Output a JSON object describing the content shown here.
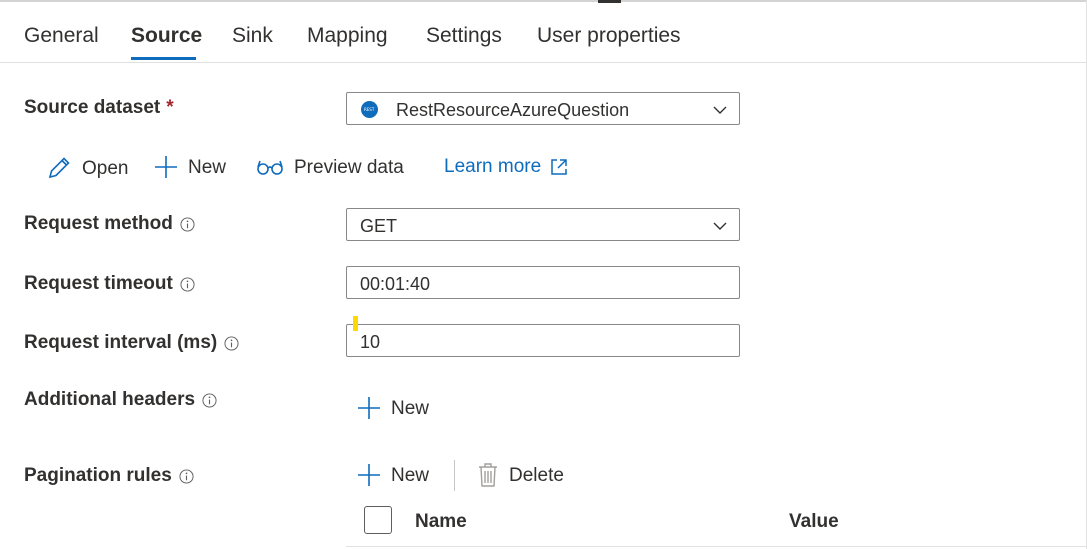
{
  "tabs": [
    {
      "label": "General"
    },
    {
      "label": "Source"
    },
    {
      "label": "Sink"
    },
    {
      "label": "Mapping"
    },
    {
      "label": "Settings"
    },
    {
      "label": "User properties"
    }
  ],
  "active_tab": "Source",
  "source_dataset": {
    "label": "Source dataset",
    "required_marker": "*",
    "value": "RestResourceAzureQuestion",
    "icon": "rest-dataset-icon"
  },
  "dataset_actions": {
    "open": "Open",
    "new": "New",
    "preview": "Preview data",
    "learn_more": "Learn more"
  },
  "request_method": {
    "label": "Request method",
    "value": "GET"
  },
  "request_timeout": {
    "label": "Request timeout",
    "value": "00:01:40"
  },
  "request_interval": {
    "label": "Request interval (ms)",
    "value": "10"
  },
  "additional_headers": {
    "label": "Additional headers",
    "new": "New"
  },
  "pagination_rules": {
    "label": "Pagination rules",
    "new": "New",
    "delete": "Delete",
    "columns": [
      "Name",
      "Value"
    ]
  },
  "colors": {
    "accent": "#0f6cbd",
    "required": "#a4262c",
    "text": "#323130"
  }
}
